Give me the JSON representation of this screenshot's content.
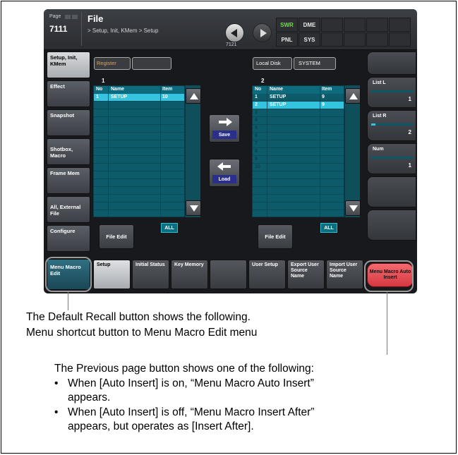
{
  "header": {
    "page_label": "Page",
    "page_number": "7111",
    "title": "File",
    "breadcrumb": "> Setup, Init, KMem > Setup",
    "nav_page": "7121"
  },
  "mode_buttons": [
    "SWR",
    "DME",
    "PNL",
    "SYS"
  ],
  "sidebar": {
    "items": [
      {
        "label": "Setup, Init, KMem",
        "active": true
      },
      {
        "label": "Effect"
      },
      {
        "label": "Snapshot"
      },
      {
        "label": "Shotbox, Macro"
      },
      {
        "label": "Frame Mem"
      },
      {
        "label": "All, External File"
      },
      {
        "label": "Configure"
      }
    ],
    "menu_macro_edit": "Menu Macro Edit"
  },
  "left_panel": {
    "register_label": "Register",
    "panel_number": "1",
    "columns": [
      "No",
      "Name",
      "Item"
    ],
    "rows": [
      {
        "no": "1",
        "name": "SETUP",
        "item": "10"
      }
    ],
    "file_edit_label": "File Edit",
    "all_label": "ALL"
  },
  "right_panel": {
    "local_disk_label": "Local Disk",
    "system_label": "SYSTEM",
    "panel_number": "2",
    "columns": [
      "No",
      "Name",
      "Item"
    ],
    "rows": [
      {
        "no": "1",
        "name": "SETUP",
        "item": "9"
      },
      {
        "no": "2",
        "name": "SETUP",
        "item": "9"
      },
      {
        "no": "3"
      },
      {
        "no": "4"
      },
      {
        "no": "5"
      },
      {
        "no": "6"
      },
      {
        "no": "7"
      },
      {
        "no": "8"
      },
      {
        "no": "9"
      },
      {
        "no": "10"
      }
    ],
    "file_edit_label": "File Edit",
    "all_label": "ALL"
  },
  "center_buttons": {
    "save_label": "Save",
    "load_label": "Load"
  },
  "right_controls": [
    {
      "label": "List L",
      "value": "1",
      "fill": 0.05
    },
    {
      "label": "List R",
      "value": "2",
      "fill": 0.1
    },
    {
      "label": "Num",
      "value": "1",
      "fill": 0.02
    }
  ],
  "bottom_tabs": [
    {
      "label": "Setup",
      "active": true
    },
    {
      "label": "Initial Status"
    },
    {
      "label": "Key Memory"
    },
    {
      "label": ""
    },
    {
      "label": "User Setup"
    },
    {
      "label": "Export User Source Name"
    },
    {
      "label": "Import User Source Name"
    }
  ],
  "menu_macro_auto_insert": "Menu Macro Auto Insert",
  "annotations": {
    "default_recall_line1": "The Default Recall button shows the following.",
    "default_recall_line2": "Menu shortcut button to Menu Macro Edit menu",
    "previous_page_intro": "The Previous page button shows one of the following:",
    "bullet1_line1": "When [Auto Insert] is on, “Menu Macro Auto Insert”",
    "bullet1_line2": "appears.",
    "bullet2_line1": "When [Auto Insert] is off, “Menu Macro Insert After”",
    "bullet2_line2": "appears, but operates as [Insert After]."
  },
  "colors": {
    "list_bg": "#0c5a6a",
    "selected_row": "#35c4e0",
    "swr_accent": "#6fe04a",
    "auto_insert_red": "#e8474e",
    "callout_line": "#9a9a9a"
  }
}
